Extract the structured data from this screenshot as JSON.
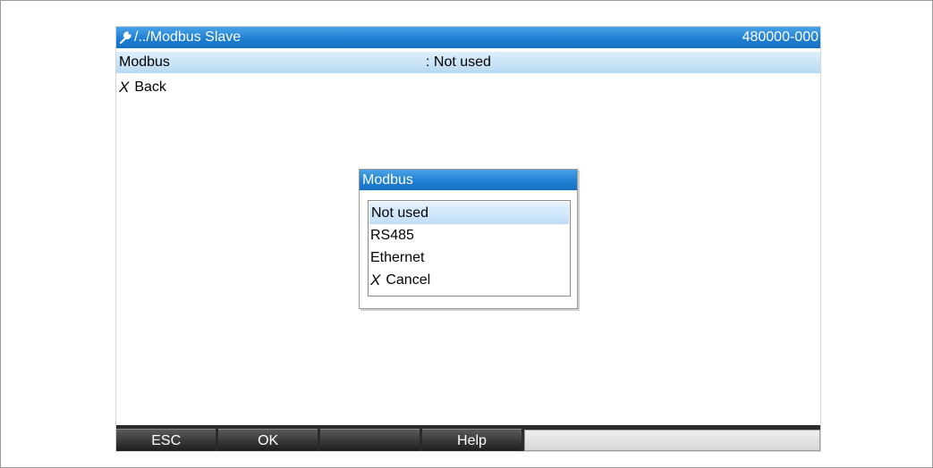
{
  "titlebar": {
    "path": "/../Modbus Slave",
    "code": "480000-000",
    "icon": "wrench-icon"
  },
  "parameter": {
    "name": "Modbus",
    "value": ": Not used"
  },
  "back": {
    "icon": "x-glyph",
    "label": "Back"
  },
  "dialog": {
    "title": "Modbus",
    "options": [
      {
        "label": "Not used",
        "selected": true
      },
      {
        "label": "RS485"
      },
      {
        "label": "Ethernet"
      },
      {
        "label": "Cancel",
        "icon": "x-glyph"
      }
    ]
  },
  "softkeys": [
    {
      "label": "ESC"
    },
    {
      "label": "OK"
    },
    {
      "label": ""
    },
    {
      "label": "Help"
    },
    {
      "label": ""
    }
  ],
  "colors": {
    "titlebar": "#1f7fd2",
    "selection": "#c0defa",
    "softkey": "#1c1c1c"
  }
}
